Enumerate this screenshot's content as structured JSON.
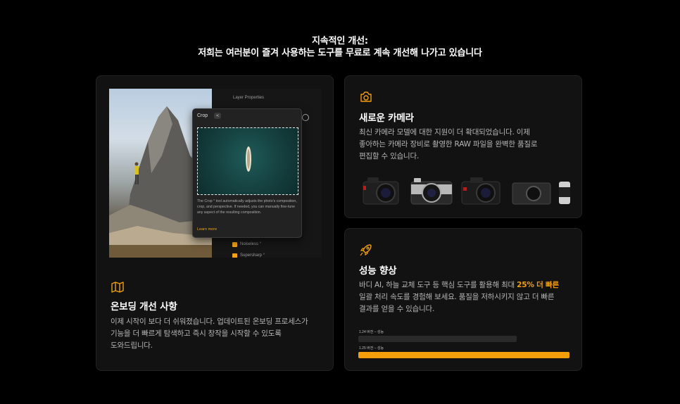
{
  "headline": {
    "line1": "지속적인 개선:",
    "line2": "저희는 여러분이 즐겨 사용하는 도구를 무료로 계속 개선해 나가고 있습니다"
  },
  "onboarding": {
    "icon": "map-icon",
    "title": "온보딩 개선 사항",
    "desc_lines": [
      "이제 시작이 보다 더 쉬워졌습니다. 업데이트된 온보딩 프로세스가",
      "기능을 더 빠르게 탐색하고 즉시 창작을 시작할 수 있도록",
      "도와드립니다."
    ],
    "mock": {
      "panel_header": "Layer Properties",
      "popup_title": "Crop ",
      "popup_text": "The Crop ° tool automatically adjusts the photo's composition, crop, and perspective. If needed, you can manually fine-tune any aspect of the resulting composition.",
      "popup_link": "Learn more",
      "item1": "Noiseless °",
      "item2": "Supersharp °"
    }
  },
  "camera": {
    "icon": "camera-icon",
    "title": "새로운 카메라",
    "desc_lines": [
      "최신 카메라 모델에 대한 지원이 더 확대되었습니다. 이제",
      "좋아하는 카메라 장비로 촬영한 RAW 파일을 완벽한 품질로",
      "편집할 수 있습니다."
    ]
  },
  "performance": {
    "icon": "rocket-icon",
    "title": "성능 향상",
    "desc_line1_pre": "바디 AI, 하늘 교체 도구 등 핵심 도구를 활용해 최대 ",
    "desc_line1_hl": "25% 더 빠른",
    "desc_lines": [
      "일괄 처리 속도를 경험해 보세요. 품질을 저하시키지 않고 더 빠른",
      "결과를 얻을 수 있습니다."
    ],
    "bars": [
      {
        "label": "1.24 버전 – 성능",
        "value": 0.75,
        "color": "#2a2a2a"
      },
      {
        "label": "1.25 버전 – 성능",
        "value": 1.0,
        "color": "#f59e0b"
      }
    ]
  },
  "colors": {
    "accent": "#f59e0b",
    "card_bg": "#121212",
    "page_bg": "#000000"
  }
}
